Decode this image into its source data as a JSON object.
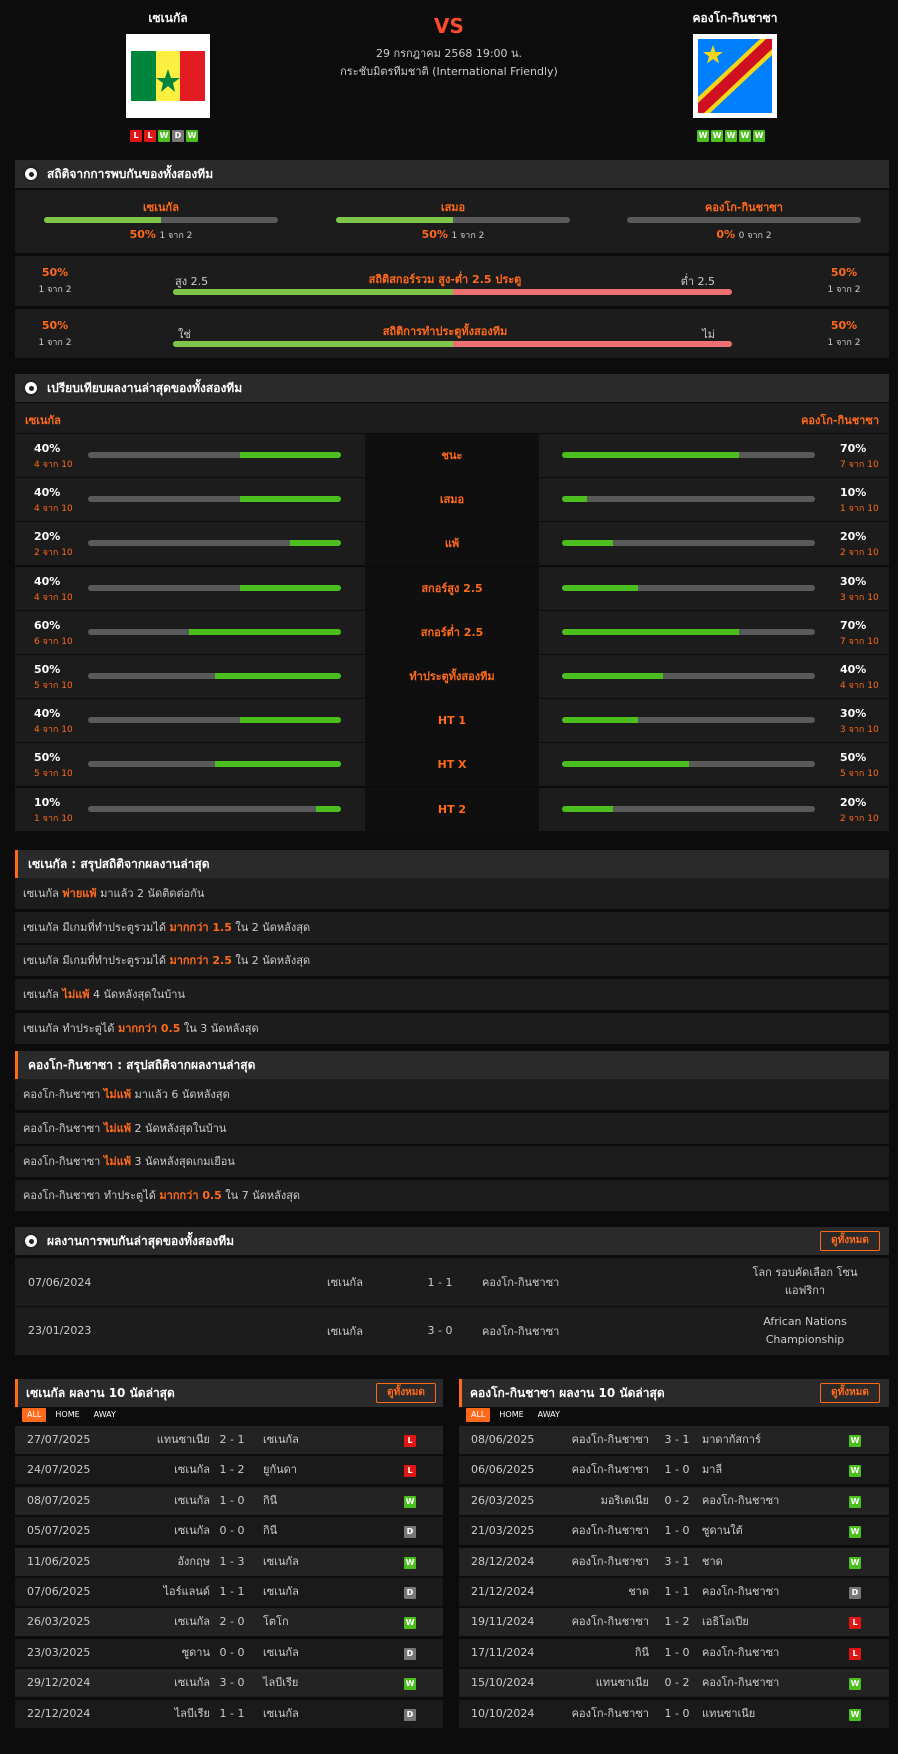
{
  "match": {
    "home": "เซเนกัล",
    "away": "คองโก-กินชาซา",
    "vs": "VS",
    "date": "29 กรกฎาคม 2568 19:00 น.",
    "competition": "กระชับมิตรทีมชาติ (International Friendly)",
    "home_form": [
      "L",
      "L",
      "W",
      "D",
      "W"
    ],
    "away_form": [
      "W",
      "W",
      "W",
      "W",
      "W"
    ]
  },
  "h2h_stats": {
    "title": "สถิติจากการพบกันของทั้งสองทีม",
    "cols": [
      {
        "label": "เซเนกัล",
        "pct": "50%",
        "of": "1 จาก 2",
        "value": 0.5
      },
      {
        "label": "เสมอ",
        "pct": "50%",
        "of": "1 จาก 2",
        "value": 0.5
      },
      {
        "label": "คองโก-กินชาซา",
        "pct": "0%",
        "of": "0 จาก 2",
        "value": 0
      }
    ],
    "ou": {
      "title": "สถิติสกอร์รวม สูง-ต่ำ 2.5 ประตู",
      "left_tag": "สูง 2.5",
      "right_tag": "ต่ำ 2.5",
      "lp": "50%",
      "lo": "1 จาก 2",
      "rp": "50%",
      "ro": "1 จาก 2",
      "value": 0.5
    },
    "btts": {
      "title": "สถิติการทำประตูทั้งสองทีม",
      "left_tag": "ใช่",
      "right_tag": "ไม่",
      "lp": "50%",
      "lo": "1 จาก 2",
      "rp": "50%",
      "ro": "1 จาก 2",
      "value": 0.5
    }
  },
  "compare": {
    "title": "เปรียบเทียบผลงานล่าสุดของทั้งสองทีม",
    "home": "เซเนกัล",
    "away": "คองโก-กินชาซา",
    "rows": [
      {
        "label": "ชนะ",
        "hp": "40%",
        "ho": "4 จาก 10",
        "hv": 0.4,
        "ap": "70%",
        "ao": "7 จาก 10",
        "av": 0.7
      },
      {
        "label": "เสมอ",
        "hp": "40%",
        "ho": "4 จาก 10",
        "hv": 0.4,
        "ap": "10%",
        "ao": "1 จาก 10",
        "av": 0.1
      },
      {
        "label": "แพ้",
        "hp": "20%",
        "ho": "2 จาก 10",
        "hv": 0.2,
        "ap": "20%",
        "ao": "2 จาก 10",
        "av": 0.2
      },
      {
        "label": "สกอร์สูง 2.5",
        "hp": "40%",
        "ho": "4 จาก 10",
        "hv": 0.4,
        "ap": "30%",
        "ao": "3 จาก 10",
        "av": 0.3
      },
      {
        "label": "สกอร์ต่ำ 2.5",
        "hp": "60%",
        "ho": "6 จาก 10",
        "hv": 0.6,
        "ap": "70%",
        "ao": "7 จาก 10",
        "av": 0.7
      },
      {
        "label": "ทำประตูทั้งสองทีม",
        "hp": "50%",
        "ho": "5 จาก 10",
        "hv": 0.5,
        "ap": "40%",
        "ao": "4 จาก 10",
        "av": 0.4
      },
      {
        "label": "HT 1",
        "hp": "40%",
        "ho": "4 จาก 10",
        "hv": 0.4,
        "ap": "30%",
        "ao": "3 จาก 10",
        "av": 0.3
      },
      {
        "label": "HT X",
        "hp": "50%",
        "ho": "5 จาก 10",
        "hv": 0.5,
        "ap": "50%",
        "ao": "5 จาก 10",
        "av": 0.5
      },
      {
        "label": "HT 2",
        "hp": "10%",
        "ho": "1 จาก 10",
        "hv": 0.1,
        "ap": "20%",
        "ao": "2 จาก 10",
        "av": 0.2
      }
    ]
  },
  "home_summary": {
    "title": "เซเนกัล : สรุปสถิติจากผลงานล่าสุด",
    "rows": [
      {
        "a": "เซเนกัล ",
        "h": "พ่ายแพ้",
        "b": " มาแล้ว 2 นัดติดต่อกัน"
      },
      {
        "a": "เซเนกัล มีเกมที่ทำประตูรวมได้ ",
        "h": "มากกว่า 1.5",
        "b": " ใน 2 นัดหลังสุด"
      },
      {
        "a": "เซเนกัล มีเกมที่ทำประตูรวมได้ ",
        "h": "มากกว่า 2.5",
        "b": " ใน 2 นัดหลังสุด"
      },
      {
        "a": "เซเนกัล ",
        "h": "ไม่แพ้",
        "b": " 4 นัดหลังสุดในบ้าน"
      },
      {
        "a": "เซเนกัล ทำประตูได้ ",
        "h": "มากกว่า 0.5",
        "b": " ใน 3 นัดหลังสุด"
      }
    ]
  },
  "away_summary": {
    "title": "คองโก-กินชาซา : สรุปสถิติจากผลงานล่าสุด",
    "rows": [
      {
        "a": "คองโก-กินชาซา ",
        "h": "ไม่แพ้",
        "b": " มาแล้ว 6 นัดหลังสุด"
      },
      {
        "a": "คองโก-กินชาซา ",
        "h": "ไม่แพ้",
        "b": " 2 นัดหลังสุดในบ้าน"
      },
      {
        "a": "คองโก-กินชาซา ",
        "h": "ไม่แพ้",
        "b": " 3 นัดหลังสุดเกมเยือน"
      },
      {
        "a": "คองโก-กินชาซา ทำประตูได้ ",
        "h": "มากกว่า 0.5",
        "b": " ใน 7 นัดหลังสุด"
      }
    ]
  },
  "h2h": {
    "title": "ผลงานการพบกันล่าสุดของทั้งสองทีม",
    "all": "ดูทั้งหมด",
    "rows": [
      {
        "date": "07/06/2024",
        "home": "เซเนกัล",
        "score": "1 - 1",
        "away": "คองโก-กินชาซา",
        "comp": "โลก รอบคัดเลือก โซนแอฟริกา"
      },
      {
        "date": "23/01/2023",
        "home": "เซเนกัล",
        "score": "3 - 0",
        "away": "คองโก-กินชาซา",
        "comp": "African Nations Championship"
      }
    ]
  },
  "tabs": [
    "ALL",
    "HOME",
    "AWAY"
  ],
  "home_last": {
    "title": "เซเนกัล ผลงาน 10 นัดล่าสุด",
    "all": "ดูทั้งหมด",
    "rows": [
      {
        "date": "27/07/2025",
        "home": "แทนซาเนีย",
        "score": "2 - 1",
        "away": "เซเนกัล",
        "res": "L"
      },
      {
        "date": "24/07/2025",
        "home": "เซเนกัล",
        "score": "1 - 2",
        "away": "ยูกันดา",
        "res": "L"
      },
      {
        "date": "08/07/2025",
        "home": "เซเนกัล",
        "score": "1 - 0",
        "away": "กินี",
        "res": "W"
      },
      {
        "date": "05/07/2025",
        "home": "เซเนกัล",
        "score": "0 - 0",
        "away": "กินี",
        "res": "D"
      },
      {
        "date": "11/06/2025",
        "home": "อังกฤษ",
        "score": "1 - 3",
        "away": "เซเนกัล",
        "res": "W"
      },
      {
        "date": "07/06/2025",
        "home": "ไอร์แลนด์",
        "score": "1 - 1",
        "away": "เซเนกัล",
        "res": "D"
      },
      {
        "date": "26/03/2025",
        "home": "เซเนกัล",
        "score": "2 - 0",
        "away": "โตโก",
        "res": "W"
      },
      {
        "date": "23/03/2025",
        "home": "ซูดาน",
        "score": "0 - 0",
        "away": "เซเนกัล",
        "res": "D"
      },
      {
        "date": "29/12/2024",
        "home": "เซเนกัล",
        "score": "3 - 0",
        "away": "ไลบีเรีย",
        "res": "W"
      },
      {
        "date": "22/12/2024",
        "home": "ไลบีเรีย",
        "score": "1 - 1",
        "away": "เซเนกัล",
        "res": "D"
      }
    ]
  },
  "away_last": {
    "title": "คองโก-กินชาซา ผลงาน 10 นัดล่าสุด",
    "all": "ดูทั้งหมด",
    "rows": [
      {
        "date": "08/06/2025",
        "home": "คองโก-กินชาซา",
        "score": "3 - 1",
        "away": "มาดากัสการ์",
        "res": "W"
      },
      {
        "date": "06/06/2025",
        "home": "คองโก-กินชาซา",
        "score": "1 - 0",
        "away": "มาลี",
        "res": "W"
      },
      {
        "date": "26/03/2025",
        "home": "มอริเตเนีย",
        "score": "0 - 2",
        "away": "คองโก-กินชาซา",
        "res": "W"
      },
      {
        "date": "21/03/2025",
        "home": "คองโก-กินชาซา",
        "score": "1 - 0",
        "away": "ซูดานใต้",
        "res": "W"
      },
      {
        "date": "28/12/2024",
        "home": "คองโก-กินชาซา",
        "score": "3 - 1",
        "away": "ชาด",
        "res": "W"
      },
      {
        "date": "21/12/2024",
        "home": "ชาด",
        "score": "1 - 1",
        "away": "คองโก-กินชาซา",
        "res": "D"
      },
      {
        "date": "19/11/2024",
        "home": "คองโก-กินชาซา",
        "score": "1 - 2",
        "away": "เอธิโอเปีย",
        "res": "L"
      },
      {
        "date": "17/11/2024",
        "home": "กินี",
        "score": "1 - 0",
        "away": "คองโก-กินชาซา",
        "res": "L"
      },
      {
        "date": "15/10/2024",
        "home": "แทนซาเนีย",
        "score": "0 - 2",
        "away": "คองโก-กินชาซา",
        "res": "W"
      },
      {
        "date": "10/10/2024",
        "home": "คองโก-กินชาซา",
        "score": "1 - 0",
        "away": "แทนซาเนีย",
        "res": "W"
      }
    ]
  }
}
